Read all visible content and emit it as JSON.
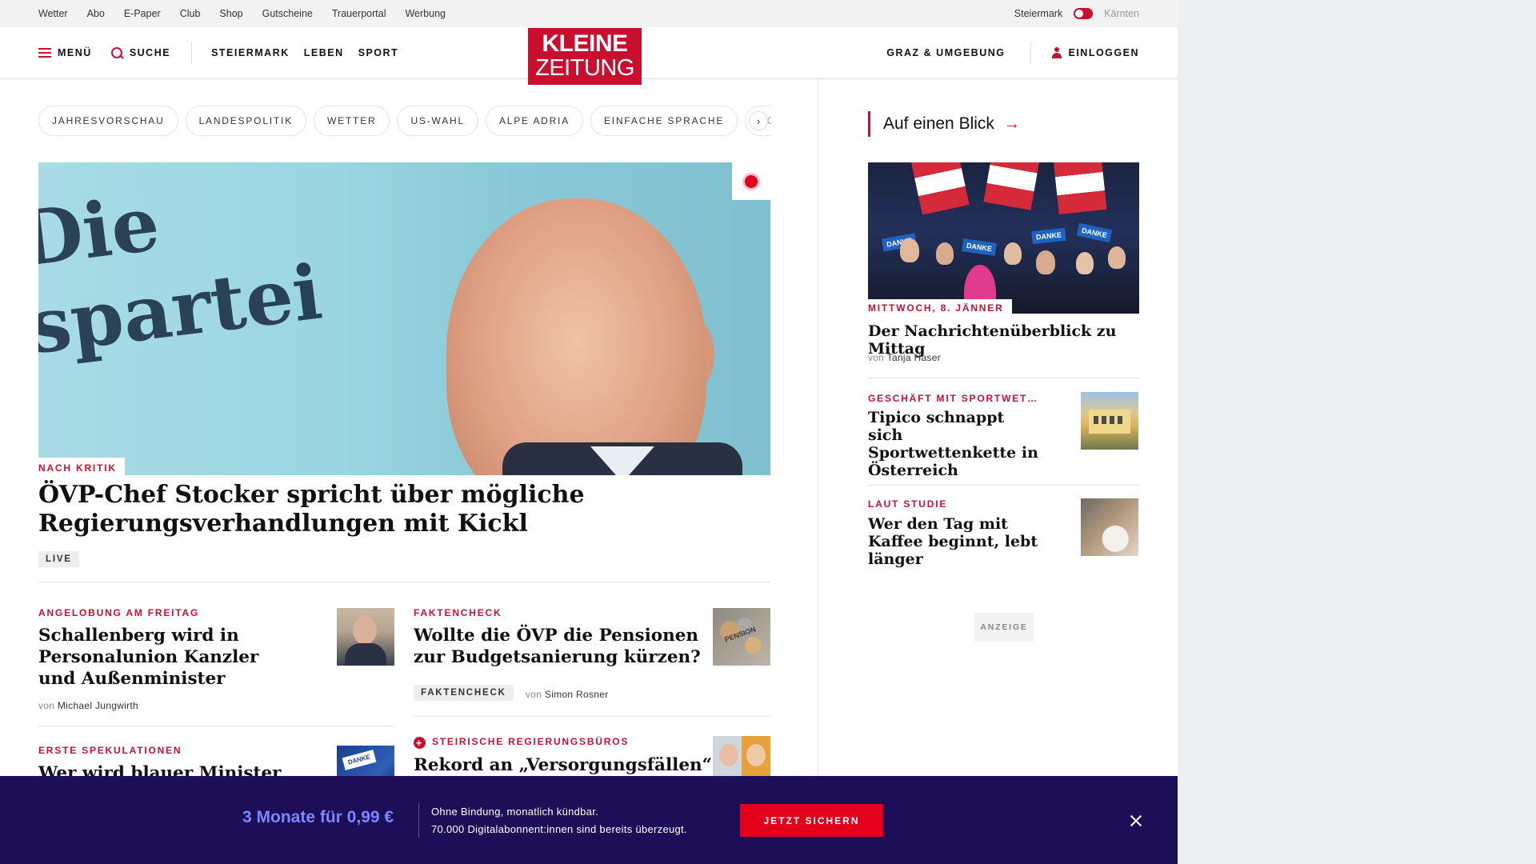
{
  "topbar": {
    "links": [
      "Wetter",
      "Abo",
      "E-Paper",
      "Club",
      "Shop",
      "Gutscheine",
      "Trauerportal",
      "Werbung"
    ],
    "region_on": "Steiermark",
    "region_off": "Kärnten"
  },
  "header": {
    "menu_label": "MENÜ",
    "search_label": "SUCHE",
    "nav": [
      "STEIERMARK",
      "LEBEN",
      "SPORT"
    ],
    "logo_line1": "KLEINE",
    "logo_line2": "ZEITUNG",
    "region_link": "GRAZ & UMGEBUNG",
    "login_label": "EINLOGGEN"
  },
  "chips": [
    "JAHRESVORSCHAU",
    "LANDESPOLITIK",
    "WETTER",
    "US-WAHL",
    "ALPE ADRIA",
    "EINFACHE SPRACHE",
    "DOS"
  ],
  "hero": {
    "image_text": "Die\nspartei",
    "kicker": "NACH KRITIK",
    "title": "ÖVP-Chef Stocker spricht über mögliche Regierungsverhandlungen mit Kickl",
    "tag": "LIVE"
  },
  "articles": [
    {
      "kicker": "ANGELOBUNG AM FREITAG",
      "title": "Schallenberg wird in Personalunion Kanzler und Außenminister",
      "von": "von",
      "author": "Michael Jungwirth"
    },
    {
      "kicker": "FAKTENCHECK",
      "title": "Wollte die ÖVP die Pensionen zur Budgetsanierung kürzen?",
      "tag": "FAKTENCHECK",
      "von": "von",
      "author": "Simon Rosner",
      "thumb_text": "PENSION"
    },
    {
      "kicker": "ERSTE SPEKULATIONEN",
      "title": "Wer wird blauer Minister",
      "thumb_text": "DANKE"
    },
    {
      "kicker": "STEIRISCHE REGIERUNGSBÜROS",
      "title": "Rekord an „Versorgungsfällen“",
      "plus": "+"
    }
  ],
  "sidebar": {
    "heading": "Auf einen Blick",
    "arrow": "→",
    "lead": {
      "kicker": "MITTWOCH, 8. JÄNNER",
      "title": "Der Nachrichtenüberblick zu Mittag",
      "von": "von",
      "author": "Tanja Haser"
    },
    "items": [
      {
        "kicker": "GESCHÄFT MIT SPORTWET…",
        "title": "Tipico schnappt sich Sportwettenkette in Österreich"
      },
      {
        "kicker": "LAUT STUDIE",
        "title": "Wer den Tag mit Kaffee beginnt, lebt länger"
      }
    ],
    "ad_label": "ANZEIGE"
  },
  "banner": {
    "price": "3 Monate für 0,99 €",
    "line1": "Ohne Bindung, monatlich kündbar.",
    "line2": "70.000 Digitalabonnent:innen sind bereits überzeugt.",
    "cta": "JETZT SICHERN"
  },
  "colors": {
    "brand_red": "#c8102e",
    "banner_bg": "#1e0d57",
    "banner_price": "#7b86ff",
    "cta_red": "#e2001a"
  }
}
